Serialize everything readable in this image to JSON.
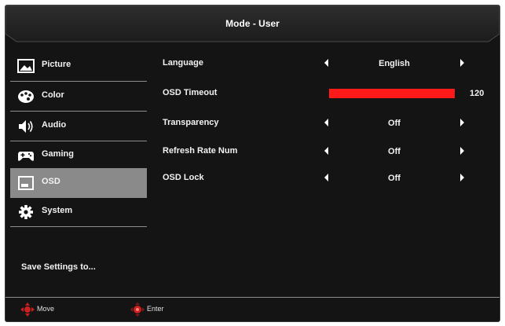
{
  "header": {
    "title": "Mode - User"
  },
  "sidebar": {
    "items": [
      {
        "label": "Picture",
        "icon": "picture-icon",
        "selected": false
      },
      {
        "label": "Color",
        "icon": "palette-icon",
        "selected": false
      },
      {
        "label": "Audio",
        "icon": "speaker-icon",
        "selected": false
      },
      {
        "label": "Gaming",
        "icon": "gamepad-icon",
        "selected": false
      },
      {
        "label": "OSD",
        "icon": "osd-window-icon",
        "selected": true
      },
      {
        "label": "System",
        "icon": "gear-icon",
        "selected": false
      }
    ],
    "save_label": "Save Settings to..."
  },
  "settings": {
    "language": {
      "label": "Language",
      "value": "English"
    },
    "osd_timeout": {
      "label": "OSD Timeout",
      "value": "120",
      "fill_fraction": 1.0
    },
    "transparency": {
      "label": "Transparency",
      "value": "Off"
    },
    "refresh_rate_num": {
      "label": "Refresh Rate Num",
      "value": "Off"
    },
    "osd_lock": {
      "label": "OSD Lock",
      "value": "Off"
    }
  },
  "footer": {
    "move_label": "Move",
    "enter_label": "Enter"
  },
  "colors": {
    "accent_red": "#ff1a1a",
    "selected_bg": "#8a8a8a",
    "panel_bg": "#141414"
  }
}
